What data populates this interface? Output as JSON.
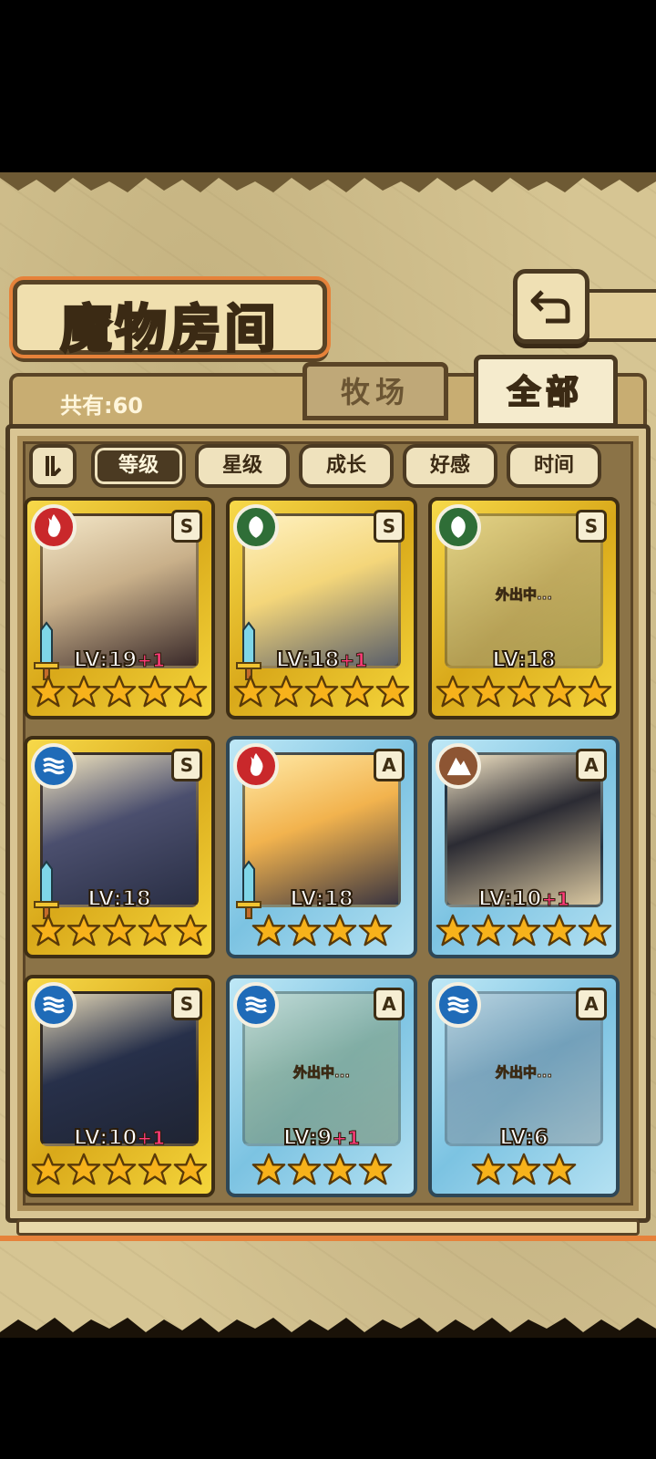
{
  "header": {
    "title": "魔物房间",
    "count_label": "共有:60"
  },
  "tabs": [
    {
      "label": "牧场",
      "active": false
    },
    {
      "label": "全部",
      "active": true
    }
  ],
  "sort": {
    "buttons": [
      {
        "label": "等级",
        "active": true
      },
      {
        "label": "星级",
        "active": false
      },
      {
        "label": "成长",
        "active": false
      },
      {
        "label": "好感",
        "active": false
      },
      {
        "label": "时间",
        "active": false
      }
    ]
  },
  "monsters": [
    {
      "level": "LV:19",
      "bonus": "+1",
      "stars": 5,
      "rank": "S",
      "element": "fire",
      "frame": "gold",
      "weapon": true,
      "away": false,
      "away_label": ""
    },
    {
      "level": "LV:18",
      "bonus": "+1",
      "stars": 5,
      "rank": "S",
      "element": "leaf",
      "frame": "gold",
      "weapon": true,
      "away": false,
      "away_label": ""
    },
    {
      "level": "LV:18",
      "bonus": "",
      "stars": 5,
      "rank": "S",
      "element": "leaf",
      "frame": "gold",
      "weapon": false,
      "away": true,
      "away_label": "外出中..."
    },
    {
      "level": "LV:18",
      "bonus": "",
      "stars": 5,
      "rank": "S",
      "element": "water",
      "frame": "gold",
      "weapon": true,
      "away": false,
      "away_label": ""
    },
    {
      "level": "LV:18",
      "bonus": "",
      "stars": 4,
      "rank": "A",
      "element": "fire",
      "frame": "blue",
      "weapon": true,
      "away": false,
      "away_label": ""
    },
    {
      "level": "LV:10",
      "bonus": "+1",
      "stars": 5,
      "rank": "A",
      "element": "earth",
      "frame": "blue",
      "weapon": false,
      "away": false,
      "away_label": ""
    },
    {
      "level": "LV:10",
      "bonus": "+1",
      "stars": 5,
      "rank": "S",
      "element": "water",
      "frame": "gold",
      "weapon": false,
      "away": false,
      "away_label": ""
    },
    {
      "level": "LV:9",
      "bonus": "+1",
      "stars": 4,
      "rank": "A",
      "element": "water",
      "frame": "blue",
      "weapon": false,
      "away": true,
      "away_label": "外出中..."
    },
    {
      "level": "LV:6",
      "bonus": "",
      "stars": 3,
      "rank": "A",
      "element": "water",
      "frame": "blue",
      "weapon": false,
      "away": true,
      "away_label": "外出中..."
    }
  ],
  "colors": {
    "fire": "#c9282b",
    "leaf": "#2f6e37",
    "water": "#1f6bb8",
    "earth": "#8d5533",
    "star": "#f7b21b",
    "accent_orange": "#e6823a"
  },
  "icons": {
    "back": "return-arrow-icon",
    "sort_toggle": "sort-order-icon",
    "weapon": "sword-icon",
    "star": "star-icon"
  }
}
